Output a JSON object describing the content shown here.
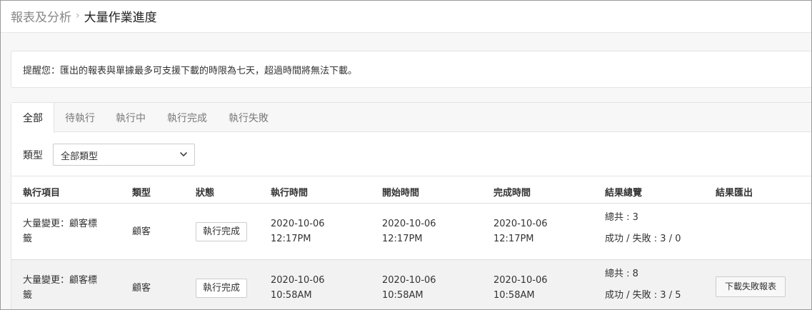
{
  "breadcrumb": {
    "parent": "報表及分析",
    "separator": "›",
    "current": "大量作業進度"
  },
  "notice": {
    "text": "提醒您：匯出的報表與單據最多可支援下載的時限為七天，超過時間將無法下載。"
  },
  "tabs": [
    {
      "label": "全部",
      "active": true
    },
    {
      "label": "待執行",
      "active": false
    },
    {
      "label": "執行中",
      "active": false
    },
    {
      "label": "執行完成",
      "active": false
    },
    {
      "label": "執行失敗",
      "active": false
    }
  ],
  "filter": {
    "label": "類型",
    "selected": "全部類型",
    "icon": "chevron-down-icon"
  },
  "table": {
    "columns": [
      "執行項目",
      "類型",
      "狀態",
      "執行時間",
      "開始時間",
      "完成時間",
      "結果總覽",
      "結果匯出"
    ],
    "rows": [
      {
        "item": [
          "大量變更：顧客標",
          "籤"
        ],
        "type": "顧客",
        "status": "執行完成",
        "exec_date": "2020-10-06",
        "exec_time": "12:17PM",
        "start_date": "2020-10-06",
        "start_time": "12:17PM",
        "done_date": "2020-10-06",
        "done_time": "12:17PM",
        "total": "總共 : 3",
        "success_fail": "成功 / 失敗 : 3 / 0",
        "export_label": ""
      },
      {
        "item": [
          "大量變更：顧客標",
          "籤"
        ],
        "type": "顧客",
        "status": "執行完成",
        "exec_date": "2020-10-06",
        "exec_time": "10:58AM",
        "start_date": "2020-10-06",
        "start_time": "10:58AM",
        "done_date": "2020-10-06",
        "done_time": "10:58AM",
        "total": "總共 : 8",
        "success_fail": "成功 / 失敗 : 3 / 5",
        "export_label": "下載失敗報表"
      }
    ]
  }
}
